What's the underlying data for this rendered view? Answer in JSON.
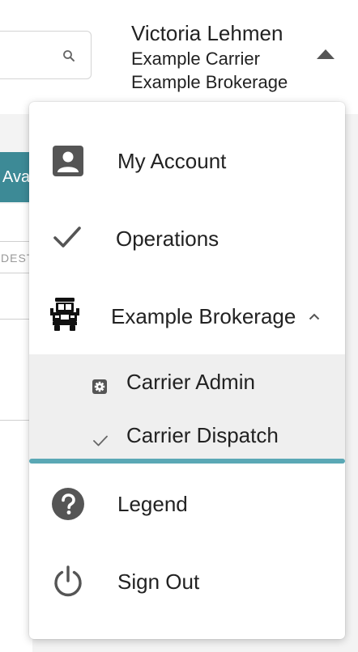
{
  "background": {
    "partial_button_text": "Ava",
    "partial_column_text": "DEST"
  },
  "user": {
    "name": "Victoria Lehmen",
    "carrier": "Example Carrier",
    "brokerage": "Example Brokerage"
  },
  "menu": {
    "my_account": "My Account",
    "operations": "Operations",
    "brokerage": "Example Brokerage",
    "submenu": {
      "carrier_admin": "Carrier Admin",
      "carrier_dispatch": "Carrier Dispatch"
    },
    "legend": "Legend",
    "sign_out": "Sign Out"
  },
  "icons": {
    "my_account": "account-box-icon",
    "operations": "checkmark-icon",
    "brokerage": "truck-icon",
    "carrier_admin": "gear-icon",
    "carrier_dispatch": "checkmark-icon",
    "legend": "help-circle-icon",
    "sign_out": "power-icon",
    "search": "search-icon"
  },
  "colors": {
    "accent_teal": "#5aa8b5",
    "button_teal": "#3d8a96",
    "icon_gray": "#555555",
    "submenu_bg": "#efefef"
  }
}
